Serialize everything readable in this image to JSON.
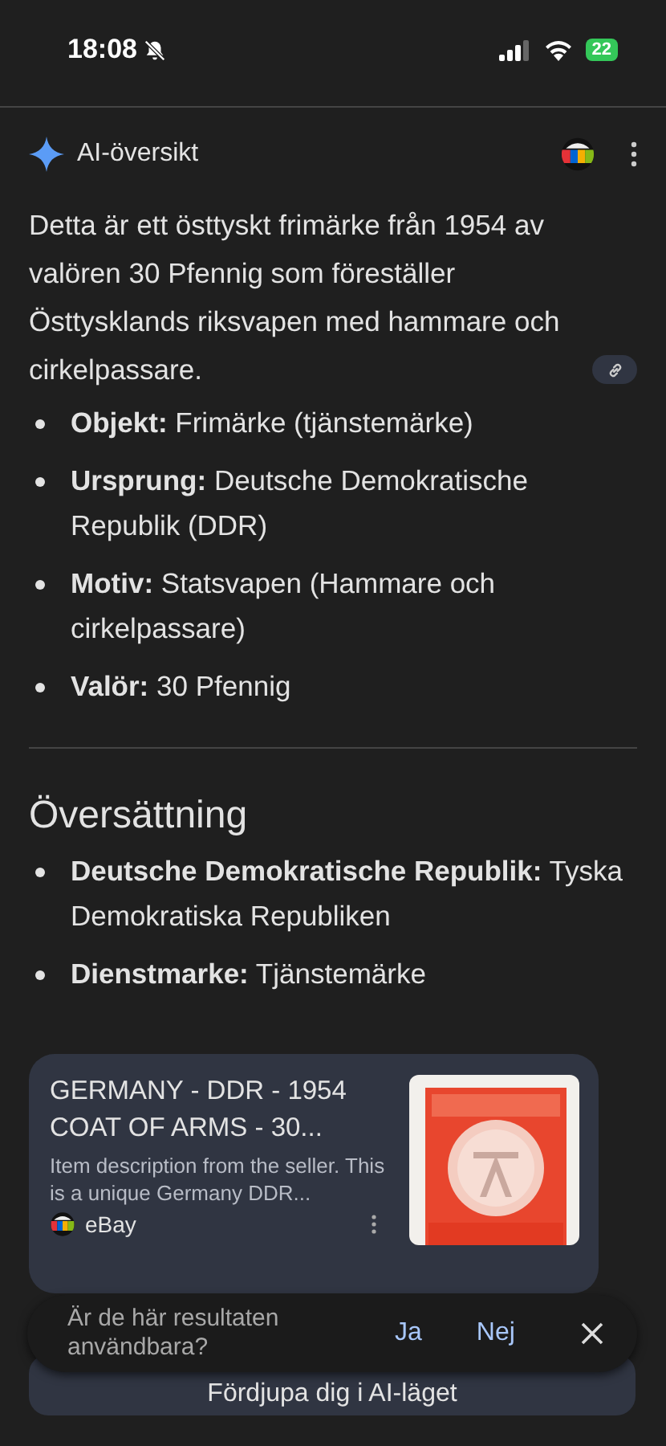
{
  "status_bar": {
    "time": "18:08",
    "silent": true,
    "battery": "22"
  },
  "ai_overview": {
    "title": "AI-översikt",
    "summary": "Detta är ett östtyskt frimärke från 1954 av valören 30 Pfennig som föreställer Östtysklands riksvapen med hammare och cirkelpassare.",
    "facts": [
      "**Objekt:** Frimärke (tjänstemärke)",
      "**Ursprung:** Deutsche Demokratische Republik (DDR)",
      "**Motiv:** Statsvapen (Hammare och cirkelpassare)",
      "**Valör:** 30 Pfennig"
    ]
  },
  "translation": {
    "heading": "Översättning",
    "items": [
      "**Deutsche Demokratische Republik:** Tyska Demokratiska Republiken",
      "**Dienstmarke:** Tjänstemärke"
    ]
  },
  "source_card": {
    "title": "GERMANY - DDR - 1954 COAT OF ARMS - 30...",
    "description": "Item description from the seller. This is a unique Germany DDR...",
    "source": "eBay"
  },
  "feedback": {
    "question": "Är de här resultaten användbara?",
    "yes": "Ja",
    "no": "Nej"
  },
  "ai_mode_button": "Fördjupa dig i AI-läget"
}
